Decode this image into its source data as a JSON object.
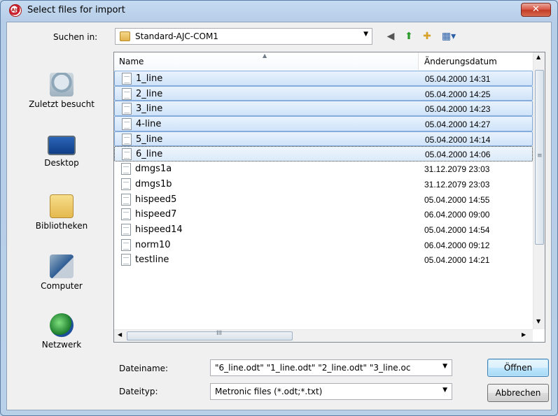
{
  "window": {
    "title": "Select files for import",
    "close_label": "✕"
  },
  "lookin": {
    "label": "Suchen in:",
    "value": "Standard-AJC-COM1"
  },
  "places": [
    {
      "label": "Zuletzt besucht",
      "icon": "recent-places-icon"
    },
    {
      "label": "Desktop",
      "icon": "desktop-icon"
    },
    {
      "label": "Bibliotheken",
      "icon": "libraries-icon"
    },
    {
      "label": "Computer",
      "icon": "computer-icon"
    },
    {
      "label": "Netzwerk",
      "icon": "network-icon"
    }
  ],
  "columns": {
    "name": "Name",
    "date": "Änderungsdatum"
  },
  "files": [
    {
      "name": "1_line",
      "date": "05.04.2000 14:31",
      "selected": true
    },
    {
      "name": "2_line",
      "date": "05.04.2000 14:25",
      "selected": true
    },
    {
      "name": "3_line",
      "date": "05.04.2000 14:23",
      "selected": true
    },
    {
      "name": "4-line",
      "date": "05.04.2000 14:27",
      "selected": true
    },
    {
      "name": "5_line",
      "date": "05.04.2000 14:14",
      "selected": true
    },
    {
      "name": "6_line",
      "date": "05.04.2000 14:06",
      "selected": true,
      "focused": true
    },
    {
      "name": "dmgs1a",
      "date": "31.12.2079 23:03",
      "selected": false
    },
    {
      "name": "dmgs1b",
      "date": "31.12.2079 23:03",
      "selected": false
    },
    {
      "name": "hispeed5",
      "date": "05.04.2000 14:55",
      "selected": false
    },
    {
      "name": "hispeed7",
      "date": "06.04.2000 09:00",
      "selected": false
    },
    {
      "name": "hispeed14",
      "date": "05.04.2000 14:54",
      "selected": false
    },
    {
      "name": "norm10",
      "date": "06.04.2000 09:12",
      "selected": false
    },
    {
      "name": "testline",
      "date": "05.04.2000 14:21",
      "selected": false
    }
  ],
  "filename": {
    "label": "Dateiname:",
    "value": "\"6_line.odt\" \"1_line.odt\" \"2_line.odt\" \"3_line.oc"
  },
  "filetype": {
    "label": "Dateityp:",
    "value": "Metronic files (*.odt;*.txt)"
  },
  "buttons": {
    "open": "Öffnen",
    "cancel": "Abbrechen"
  },
  "scroll": {
    "h_grip": "III",
    "v_grip": "≡"
  }
}
